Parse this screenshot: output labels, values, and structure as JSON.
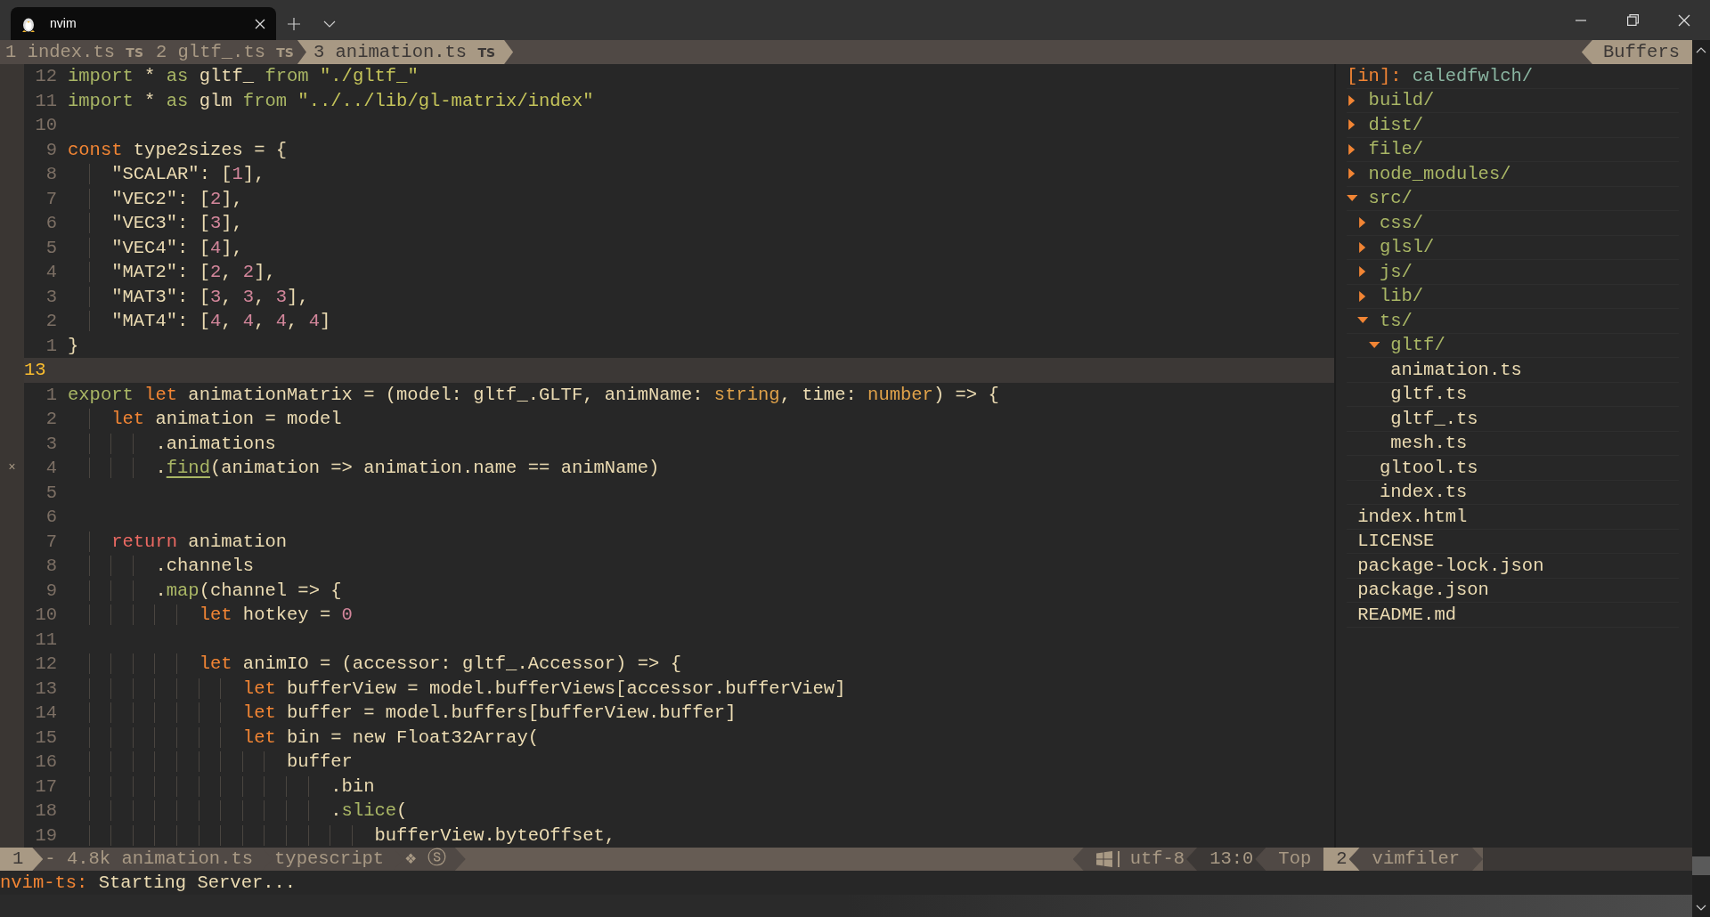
{
  "terminal": {
    "tab": {
      "title": "nvim"
    }
  },
  "tabline": {
    "tabs": [
      {
        "number": "1",
        "name": "index.ts",
        "filetype": "TS",
        "selected": false
      },
      {
        "number": "2",
        "name": "gltf_.ts",
        "filetype": "TS",
        "selected": false
      },
      {
        "number": "3",
        "name": "animation.ts",
        "filetype": "TS",
        "selected": true
      }
    ],
    "label": "Buffers"
  },
  "editor": {
    "lines": [
      {
        "number": "12",
        "current": false,
        "tokens": [
          {
            "kind": "keyword",
            "text": "import"
          },
          {
            "kind": "plain",
            "text": " * "
          },
          {
            "kind": "keyword",
            "text": "as"
          },
          {
            "kind": "plain",
            "text": " gltf_ "
          },
          {
            "kind": "keyword",
            "text": "from"
          },
          {
            "kind": "string",
            "text": " \"./gltf_\""
          }
        ]
      },
      {
        "number": "11",
        "current": false,
        "tokens": [
          {
            "kind": "keyword",
            "text": "import"
          },
          {
            "kind": "plain",
            "text": " * "
          },
          {
            "kind": "keyword",
            "text": "as"
          },
          {
            "kind": "plain",
            "text": " glm "
          },
          {
            "kind": "keyword",
            "text": "from"
          },
          {
            "kind": "string",
            "text": " \"../../lib/gl-matrix/index\""
          }
        ]
      },
      {
        "number": "10",
        "current": false
      },
      {
        "number": "9",
        "current": false,
        "tokens": [
          {
            "kind": "storage",
            "text": "const"
          },
          {
            "kind": "plain",
            "text": " type2sizes = {"
          }
        ]
      },
      {
        "number": "8",
        "current": false,
        "tokens": [
          {
            "kind": "plain",
            "text": "    \"SCALAR\": ["
          },
          {
            "kind": "number",
            "text": "1"
          },
          {
            "kind": "plain",
            "text": "],"
          }
        ]
      },
      {
        "number": "7",
        "current": false,
        "tokens": [
          {
            "kind": "plain",
            "text": "    \"VEC2\": ["
          },
          {
            "kind": "number",
            "text": "2"
          },
          {
            "kind": "plain",
            "text": "],"
          }
        ]
      },
      {
        "number": "6",
        "current": false,
        "tokens": [
          {
            "kind": "plain",
            "text": "    \"VEC3\": ["
          },
          {
            "kind": "number",
            "text": "3"
          },
          {
            "kind": "plain",
            "text": "],"
          }
        ]
      },
      {
        "number": "5",
        "current": false,
        "tokens": [
          {
            "kind": "plain",
            "text": "    \"VEC4\": ["
          },
          {
            "kind": "number",
            "text": "4"
          },
          {
            "kind": "plain",
            "text": "],"
          }
        ]
      },
      {
        "number": "4",
        "current": false,
        "tokens": [
          {
            "kind": "plain",
            "text": "    \"MAT2\": ["
          },
          {
            "kind": "number",
            "text": "2"
          },
          {
            "kind": "plain",
            "text": ", "
          },
          {
            "kind": "number",
            "text": "2"
          },
          {
            "kind": "plain",
            "text": "],"
          }
        ]
      },
      {
        "number": "3",
        "current": false,
        "tokens": [
          {
            "kind": "plain",
            "text": "    \"MAT3\": ["
          },
          {
            "kind": "number",
            "text": "3"
          },
          {
            "kind": "plain",
            "text": ", "
          },
          {
            "kind": "number",
            "text": "3"
          },
          {
            "kind": "plain",
            "text": ", "
          },
          {
            "kind": "number",
            "text": "3"
          },
          {
            "kind": "plain",
            "text": "],"
          }
        ]
      },
      {
        "number": "2",
        "current": false,
        "tokens": [
          {
            "kind": "plain",
            "text": "    \"MAT4\": ["
          },
          {
            "kind": "number",
            "text": "4"
          },
          {
            "kind": "plain",
            "text": ", "
          },
          {
            "kind": "number",
            "text": "4"
          },
          {
            "kind": "plain",
            "text": ", "
          },
          {
            "kind": "number",
            "text": "4"
          },
          {
            "kind": "plain",
            "text": ", "
          },
          {
            "kind": "number",
            "text": "4"
          },
          {
            "kind": "plain",
            "text": "]"
          }
        ]
      },
      {
        "number": "1",
        "current": false,
        "tokens": [
          {
            "kind": "plain",
            "text": "}"
          }
        ]
      },
      {
        "number": "13",
        "current": true
      },
      {
        "number": "1",
        "current": false,
        "tokens": [
          {
            "kind": "keyword",
            "text": "export"
          },
          {
            "kind": "storage",
            "text": " let"
          },
          {
            "kind": "plain",
            "text": " animationMatrix = (model: gltf_.GLTF, animName: "
          },
          {
            "kind": "type",
            "text": "string"
          },
          {
            "kind": "plain",
            "text": ", time: "
          },
          {
            "kind": "type",
            "text": "number"
          },
          {
            "kind": "plain",
            "text": ") => {"
          }
        ]
      },
      {
        "number": "2",
        "current": false,
        "tokens": [
          {
            "kind": "storage",
            "text": "    let"
          },
          {
            "kind": "plain",
            "text": " animation = model"
          }
        ]
      },
      {
        "number": "3",
        "current": false,
        "tokens": [
          {
            "kind": "plain",
            "text": "        .animations"
          }
        ]
      },
      {
        "number": "4",
        "current": false,
        "sign": "×",
        "tokens": [
          {
            "kind": "plain",
            "text": "        ."
          },
          {
            "kind": "function_match",
            "text": "find"
          },
          {
            "kind": "plain",
            "text": "(animation => animation.name == animName)"
          }
        ]
      },
      {
        "number": "5",
        "current": false
      },
      {
        "number": "6",
        "current": false
      },
      {
        "number": "7",
        "current": false,
        "tokens": [
          {
            "kind": "control",
            "text": "    return"
          },
          {
            "kind": "plain",
            "text": " animation"
          }
        ]
      },
      {
        "number": "8",
        "current": false,
        "tokens": [
          {
            "kind": "plain",
            "text": "        .channels"
          }
        ]
      },
      {
        "number": "9",
        "current": false,
        "tokens": [
          {
            "kind": "plain",
            "text": "        ."
          },
          {
            "kind": "function",
            "text": "map"
          },
          {
            "kind": "plain",
            "text": "(channel => {"
          }
        ]
      },
      {
        "number": "10",
        "current": false,
        "tokens": [
          {
            "kind": "storage",
            "text": "            let"
          },
          {
            "kind": "plain",
            "text": " hotkey = "
          },
          {
            "kind": "number",
            "text": "0"
          }
        ]
      },
      {
        "number": "11",
        "current": false
      },
      {
        "number": "12",
        "current": false,
        "tokens": [
          {
            "kind": "storage",
            "text": "            let"
          },
          {
            "kind": "plain",
            "text": " animIO = (accessor: gltf_.Accessor) => {"
          }
        ]
      },
      {
        "number": "13",
        "current": false,
        "tokens": [
          {
            "kind": "storage",
            "text": "                let"
          },
          {
            "kind": "plain",
            "text": " bufferView = model.bufferViews[accessor.bufferView]"
          }
        ]
      },
      {
        "number": "14",
        "current": false,
        "tokens": [
          {
            "kind": "storage",
            "text": "                let"
          },
          {
            "kind": "plain",
            "text": " buffer = model.buffers[bufferView.buffer]"
          }
        ]
      },
      {
        "number": "15",
        "current": false,
        "tokens": [
          {
            "kind": "storage",
            "text": "                let"
          },
          {
            "kind": "plain",
            "text": " bin = new Float32Array("
          }
        ]
      },
      {
        "number": "16",
        "current": false,
        "tokens": [
          {
            "kind": "plain",
            "text": "                    buffer"
          }
        ]
      },
      {
        "number": "17",
        "current": false,
        "tokens": [
          {
            "kind": "plain",
            "text": "                        .bin"
          }
        ]
      },
      {
        "number": "18",
        "current": false,
        "tokens": [
          {
            "kind": "plain",
            "text": "                        ."
          },
          {
            "kind": "function",
            "text": "slice"
          },
          {
            "kind": "plain",
            "text": "("
          }
        ]
      },
      {
        "number": "19",
        "current": false,
        "tokens": [
          {
            "kind": "plain",
            "text": "                            bufferView.byteOffset,"
          }
        ]
      }
    ]
  },
  "file_tree": {
    "root": {
      "prefix": "[in]:",
      "path": "caledfwlch/"
    },
    "items": [
      {
        "name": "build/",
        "kind": "directory",
        "expanded": false
      },
      {
        "name": "dist/",
        "kind": "directory",
        "expanded": false
      },
      {
        "name": "file/",
        "kind": "directory",
        "expanded": false
      },
      {
        "name": "node_modules/",
        "kind": "directory",
        "expanded": false
      },
      {
        "name": "src/",
        "kind": "directory",
        "expanded": true,
        "children": [
          {
            "name": "css/",
            "kind": "directory",
            "expanded": false
          },
          {
            "name": "glsl/",
            "kind": "directory",
            "expanded": false
          },
          {
            "name": "js/",
            "kind": "directory",
            "expanded": false
          },
          {
            "name": "lib/",
            "kind": "directory",
            "expanded": false
          },
          {
            "name": "ts/",
            "kind": "directory",
            "expanded": true,
            "children": [
              {
                "name": "gltf/",
                "kind": "directory",
                "expanded": true,
                "children": [
                  {
                    "name": "animation.ts",
                    "kind": "file"
                  },
                  {
                    "name": "gltf.ts",
                    "kind": "file"
                  },
                  {
                    "name": "gltf_.ts",
                    "kind": "file"
                  },
                  {
                    "name": "mesh.ts",
                    "kind": "file"
                  }
                ]
              },
              {
                "name": "gltool.ts",
                "kind": "file"
              },
              {
                "name": "index.ts",
                "kind": "file"
              }
            ]
          }
        ]
      },
      {
        "name": "index.html",
        "kind": "file"
      },
      {
        "name": "LICENSE",
        "kind": "file"
      },
      {
        "name": "package-lock.json",
        "kind": "file"
      },
      {
        "name": "package.json",
        "kind": "file"
      },
      {
        "name": "README.md",
        "kind": "file"
      }
    ]
  },
  "status_bar": {
    "left": [
      {
        "text": "1",
        "kind": "number"
      },
      {
        "text": "- 4.8k animation.ts",
        "kind": "plain"
      },
      {
        "text": "typescript",
        "kind": "plain"
      },
      {
        "text": "❖ ⓢ",
        "kind": "plain"
      }
    ],
    "right": [
      {
        "text": "utf-8",
        "kind": "fileformat"
      },
      {
        "text": "13:0",
        "kind": "dark"
      },
      {
        "text": "Top",
        "kind": "plain"
      },
      {
        "text": "2",
        "kind": "number"
      },
      {
        "text": "vimfiler",
        "kind": "plain"
      }
    ]
  },
  "command_line": {
    "source": "nvim-ts:",
    "message": "Starting Server..."
  }
}
